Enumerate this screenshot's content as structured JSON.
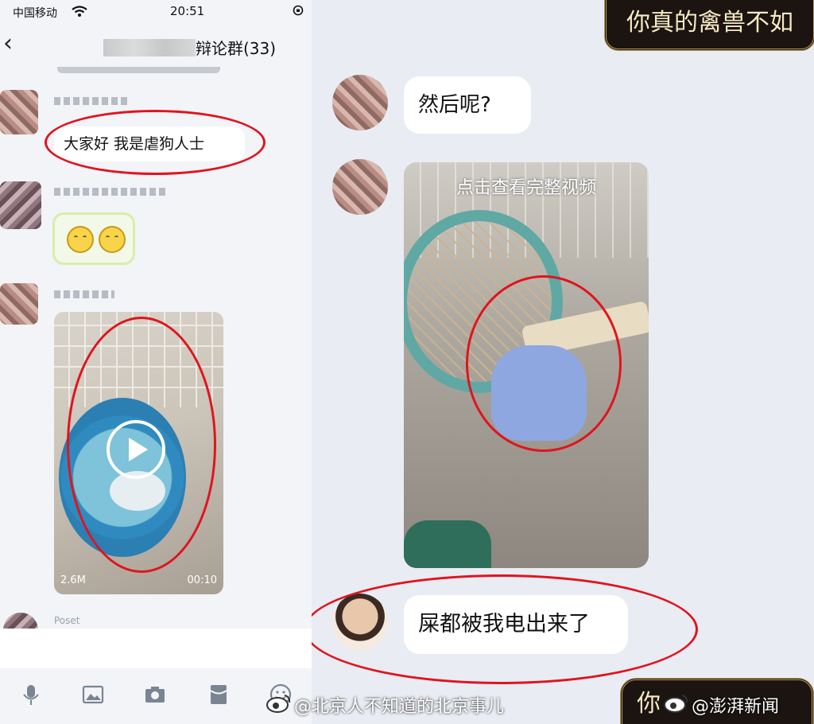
{
  "status_bar": {
    "carrier": "中国移动",
    "time": "20:51"
  },
  "chat": {
    "title_suffix": "辩论群(33)"
  },
  "messages": {
    "m1": "大家好 我是虐狗人士",
    "m3_video": {
      "size": "2.6M",
      "duration": "00:10"
    },
    "next_name": "Poset"
  },
  "right": {
    "banner_top": "你真的禽兽不如",
    "bubble_1": "然后呢?",
    "video_overlay": "点击查看完整视频",
    "bubble_2": "屎都被我电出来了",
    "banner_bottom": "你"
  },
  "watermarks": {
    "left": "@北京人不知道的北京事儿",
    "right": "@澎湃新闻"
  },
  "colors": {
    "highlight_red": "#e0141e",
    "page_bg": "#eef1f6"
  },
  "icons": [
    "back-arrow-icon",
    "wifi-icon",
    "lock-rotation-icon",
    "play-icon",
    "microphone-icon",
    "image-icon",
    "camera-icon",
    "redpacket-icon",
    "emoji-icon",
    "weibo-icon"
  ]
}
